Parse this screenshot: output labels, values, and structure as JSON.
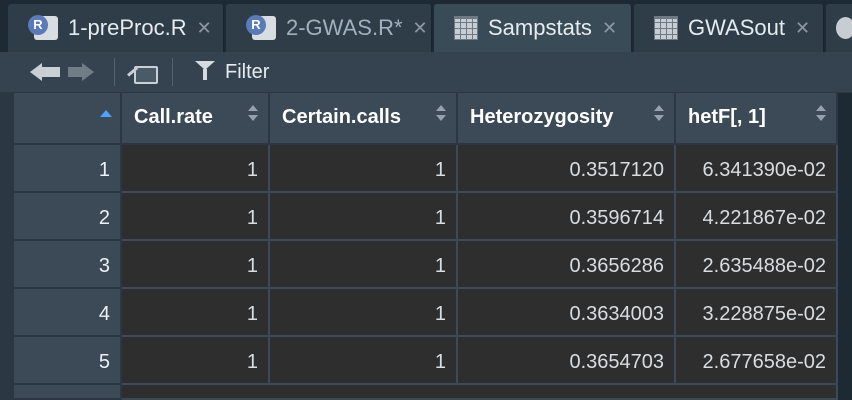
{
  "tabs": [
    {
      "label": "1-preProc.R",
      "icon": "r-script-icon",
      "active": false
    },
    {
      "label": "2-GWAS.R*",
      "icon": "r-script-icon",
      "active": false
    },
    {
      "label": "Sampstats",
      "icon": "data-grid-icon",
      "active": true
    },
    {
      "label": "GWASout",
      "icon": "data-grid-icon",
      "active": false
    }
  ],
  "tab_close_glyph": "✕",
  "r_badge": "R",
  "toolbar": {
    "filter_label": "Filter"
  },
  "table": {
    "columns": [
      "Call.rate",
      "Certain.calls",
      "Heterozygosity",
      "hetF[, 1]"
    ],
    "rows": [
      {
        "name": "1",
        "cells": [
          "1",
          "1",
          "0.3517120",
          "6.341390e-02"
        ]
      },
      {
        "name": "2",
        "cells": [
          "1",
          "1",
          "0.3596714",
          "4.221867e-02"
        ]
      },
      {
        "name": "3",
        "cells": [
          "1",
          "1",
          "0.3656286",
          "2.635488e-02"
        ]
      },
      {
        "name": "4",
        "cells": [
          "1",
          "1",
          "0.3634003",
          "3.228875e-02"
        ]
      },
      {
        "name": "5",
        "cells": [
          "1",
          "1",
          "0.3654703",
          "2.677658e-02"
        ]
      }
    ]
  },
  "colors": {
    "header_bg": "#3b4a56",
    "cell_bg": "#2e2e2e",
    "sort_accent": "#4da3ff"
  }
}
